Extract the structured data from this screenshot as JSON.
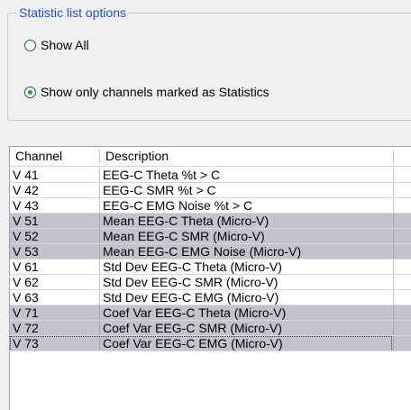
{
  "options_group": {
    "title": "Statistic list options",
    "show_all": {
      "label": "Show All",
      "checked": false
    },
    "show_only": {
      "label": "Show only channels marked as Statistics",
      "checked": true
    }
  },
  "channel_list": {
    "columns": [
      "Channel",
      "Description"
    ],
    "rows": [
      {
        "channel": "V 41",
        "description": "EEG-C Theta %t > C",
        "highlighted": false
      },
      {
        "channel": "V 42",
        "description": "EEG-C SMR %t > C",
        "highlighted": false
      },
      {
        "channel": "V 43",
        "description": "EEG-C EMG Noise %t > C",
        "highlighted": false
      },
      {
        "channel": "V 51",
        "description": "Mean EEG-C Theta (Micro-V)",
        "highlighted": true
      },
      {
        "channel": "V 52",
        "description": "Mean EEG-C SMR (Micro-V)",
        "highlighted": true
      },
      {
        "channel": "V 53",
        "description": "Mean EEG-C EMG Noise (Micro-V)",
        "highlighted": true
      },
      {
        "channel": "V 61",
        "description": "Std Dev EEG-C Theta (Micro-V)",
        "highlighted": false
      },
      {
        "channel": "V 62",
        "description": "Std Dev EEG-C SMR (Micro-V)",
        "highlighted": false
      },
      {
        "channel": "V 63",
        "description": "Std Dev EEG-C EMG (Micro-V)",
        "highlighted": false
      },
      {
        "channel": "V 71",
        "description": "Coef Var EEG-C Theta (Micro-V)",
        "highlighted": true
      },
      {
        "channel": "V 72",
        "description": "Coef Var EEG-C SMR (Micro-V)",
        "highlighted": true
      },
      {
        "channel": "V 73",
        "description": "Coef Var EEG-C EMG (Micro-V)",
        "highlighted": true,
        "focused": true
      }
    ]
  },
  "colors": {
    "group_title": "#2050c8",
    "highlight_row": "#c3c3ce",
    "radio_dot": "#21a121"
  }
}
